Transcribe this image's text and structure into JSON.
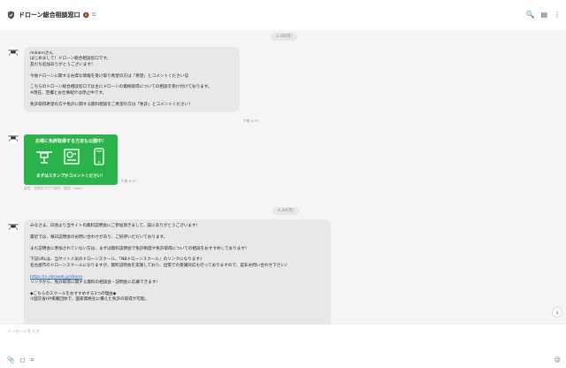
{
  "header": {
    "title": "ドローン総合相談窓口",
    "bell_icon": "🔕",
    "copy_icon": "⧉",
    "search_icon": "🔍",
    "menu_icon": "▤",
    "more_icon": "⋮"
  },
  "chat": {
    "date1": "3.28(月)",
    "date2": "4.30(月)",
    "message1": {
      "lines": [
        "mikamiさん",
        "はじめまして！ドローン総合相談窓口です。",
        "友だち追加ありがとうございます！",
        "",
        "今後ドローンに関するお得な情報を受け取り希望の方は「希望」とコメントください😊",
        "",
        "こちらのドローン総合相談窓口では主にドローンの資格取得についての相談を受け付けております。",
        "※現在、空撮とお仕事紹介は停止中です。",
        "",
        "免許取得希望の方や免許に関する無料相談をご希望の方は「免許」とコメントください！"
      ],
      "time": "午後 6:57"
    },
    "promo": {
      "title": "お得に免許取得する方法も公開中！",
      "footer": "まずはスタンプかコメントください！",
      "time": "午後 6:57"
    },
    "quick_reply": "返信 · 名前をつけて保存 · 配信 · Keep",
    "message2": {
      "lines": [
        "みなさま、日頃より当サイトの無料説明会にご参加頂きまして、誠にありがとうございます！",
        "",
        "最近では、毎日説明会のお問い合わせがあり、ご好評いただいております。",
        "",
        "まだ説明会に参加されていない方は、まずは無料説明会で免許制度や免許取得についての相談をおすすめしております！",
        "",
        "下記URLは、当サイト人気のドローンスクール、「NBドローンスクール」のリンクになります♪",
        "名古屋市のドローンスクールになりますが、無料説明会を実施しており、出張での受講対応も行っておりますので、是非お問い合わせ下さい♪",
        "",
        "https://n.nbcweb.jp/drone",
        "リンクから、免許取得に関する無料の相談会・説明会に応募できます！",
        "",
        "◆こちらのスクールをおすすめする3つの理由◆",
        "①国交省HP掲載団体で、国家資格化に備えた免許の取得が可能。"
      ]
    }
  },
  "input": {
    "placeholder": "メッセージを入力",
    "attach_icon": "📎",
    "image_icon": "◻",
    "crop_icon": "⌗",
    "emoji_icon": "☺"
  },
  "scroll_down_icon": "↓"
}
